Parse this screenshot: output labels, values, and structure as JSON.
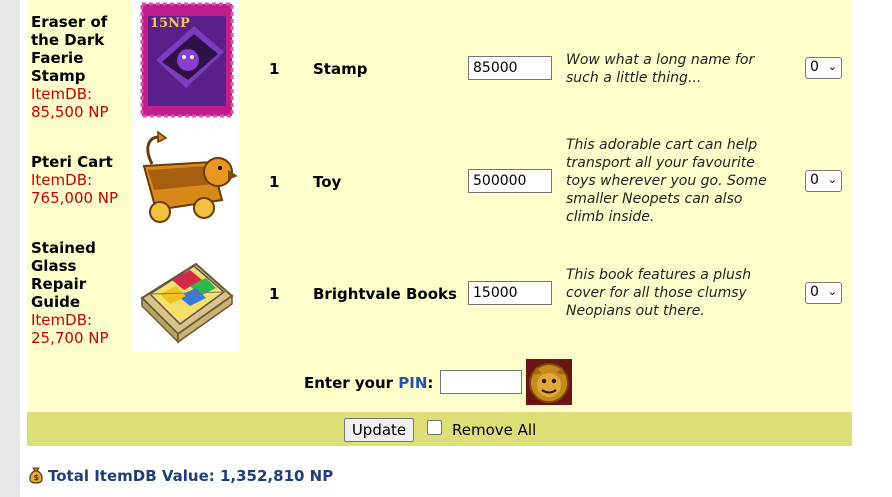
{
  "items": [
    {
      "name": "Eraser of the Dark Faerie Stamp",
      "name_lines": [
        "Eraser of",
        "the Dark",
        "Faerie",
        "Stamp"
      ],
      "itemdb_label": "ItemDB:",
      "itemdb_value": "85,500 NP",
      "image_badge": "15NP",
      "quantity": "1",
      "category": "Stamp",
      "price": "85000",
      "description_lines": [
        "Wow what a long name for",
        "such a little thing..."
      ],
      "remove_qty": "0"
    },
    {
      "name": "Pteri Cart",
      "name_lines": [
        "Pteri Cart"
      ],
      "itemdb_label": "ItemDB:",
      "itemdb_value": "765,000 NP",
      "quantity": "1",
      "category": "Toy",
      "price": "500000",
      "description_lines": [
        "This adorable cart can help",
        "transport all your favourite",
        "toys wherever you go. Some",
        "smaller Neopets can also",
        "climb inside."
      ],
      "remove_qty": "0"
    },
    {
      "name": "Stained Glass Repair Guide",
      "name_lines": [
        "Stained",
        "Glass",
        "Repair",
        "Guide"
      ],
      "itemdb_label": "ItemDB:",
      "itemdb_value": "25,700 NP",
      "quantity": "1",
      "category": "Brightvale Books",
      "price": "15000",
      "description_lines": [
        "This book features a plush",
        "cover for all those clumsy",
        "Neopians out there."
      ],
      "remove_qty": "0"
    }
  ],
  "pin": {
    "label_prefix": "Enter your ",
    "label_pin": "PIN",
    "label_suffix": ":",
    "value": "",
    "icon": "shopkeeper-icon"
  },
  "actions": {
    "update_label": "Update",
    "remove_all_label": "Remove All",
    "remove_all_checked": false
  },
  "total": {
    "icon": "money-bag-icon",
    "text": "Total ItemDB Value: 1,352,810 NP"
  },
  "colors": {
    "panel_bg": "#ffffcc",
    "bar_bg": "#dede78",
    "itemdb_red": "#cc0000",
    "pin_blue": "#2255aa",
    "total_blue": "#1f3f7a"
  }
}
